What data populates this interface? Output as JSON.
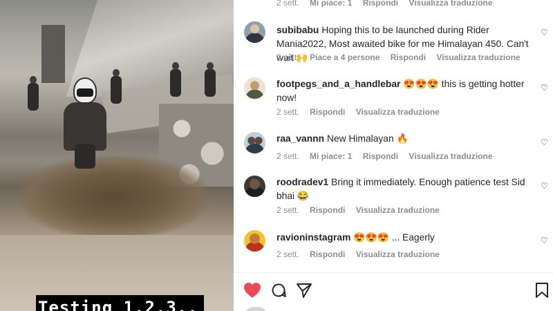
{
  "media": {
    "caption": "Testing 1,2,3.."
  },
  "comments": [
    {
      "user": "",
      "text": "",
      "time": "2 sett.",
      "likes": "Mi piace: 1",
      "reply": "Rispondi",
      "translate": "Visualizza traduzione"
    },
    {
      "user": "subibabu",
      "text": "Hoping this to be launched during Rider Mania2022, Most awaited bike for me Himalayan 450. Can't wait 🙌",
      "time": "2 sett.",
      "likes": "Piace a 4 persone",
      "reply": "Rispondi",
      "translate": "Visualizza traduzione"
    },
    {
      "user": "footpegs_and_a_handlebar",
      "text": "😍😍😍 this is getting hotter now!",
      "time": "2 sett.",
      "likes": "",
      "reply": "Rispondi",
      "translate": "Visualizza traduzione"
    },
    {
      "user": "raa_vannn",
      "text": "New Himalayan 🔥",
      "time": "2 sett.",
      "likes": "Mi piace: 1",
      "reply": "Rispondi",
      "translate": "Visualizza traduzione"
    },
    {
      "user": "roodradev1",
      "text": "Bring it immediately. Enough patience test Sid bhai 😂",
      "time": "2 sett.",
      "likes": "",
      "reply": "Rispondi",
      "translate": "Visualizza traduzione"
    },
    {
      "user": "ravioninstagram",
      "text": "😍😍😍 ... Eagerly",
      "time": "2 sett.",
      "likes": "",
      "reply": "Rispondi",
      "translate": "Visualizza traduzione"
    }
  ],
  "actions": {
    "liked": true,
    "like_icon": "heart-filled-icon",
    "comment_icon": "comment-icon",
    "share_icon": "share-icon",
    "save_icon": "bookmark-icon",
    "like_color": "#ed4956"
  },
  "icons": {
    "comment_like": "heart-outline-icon"
  }
}
